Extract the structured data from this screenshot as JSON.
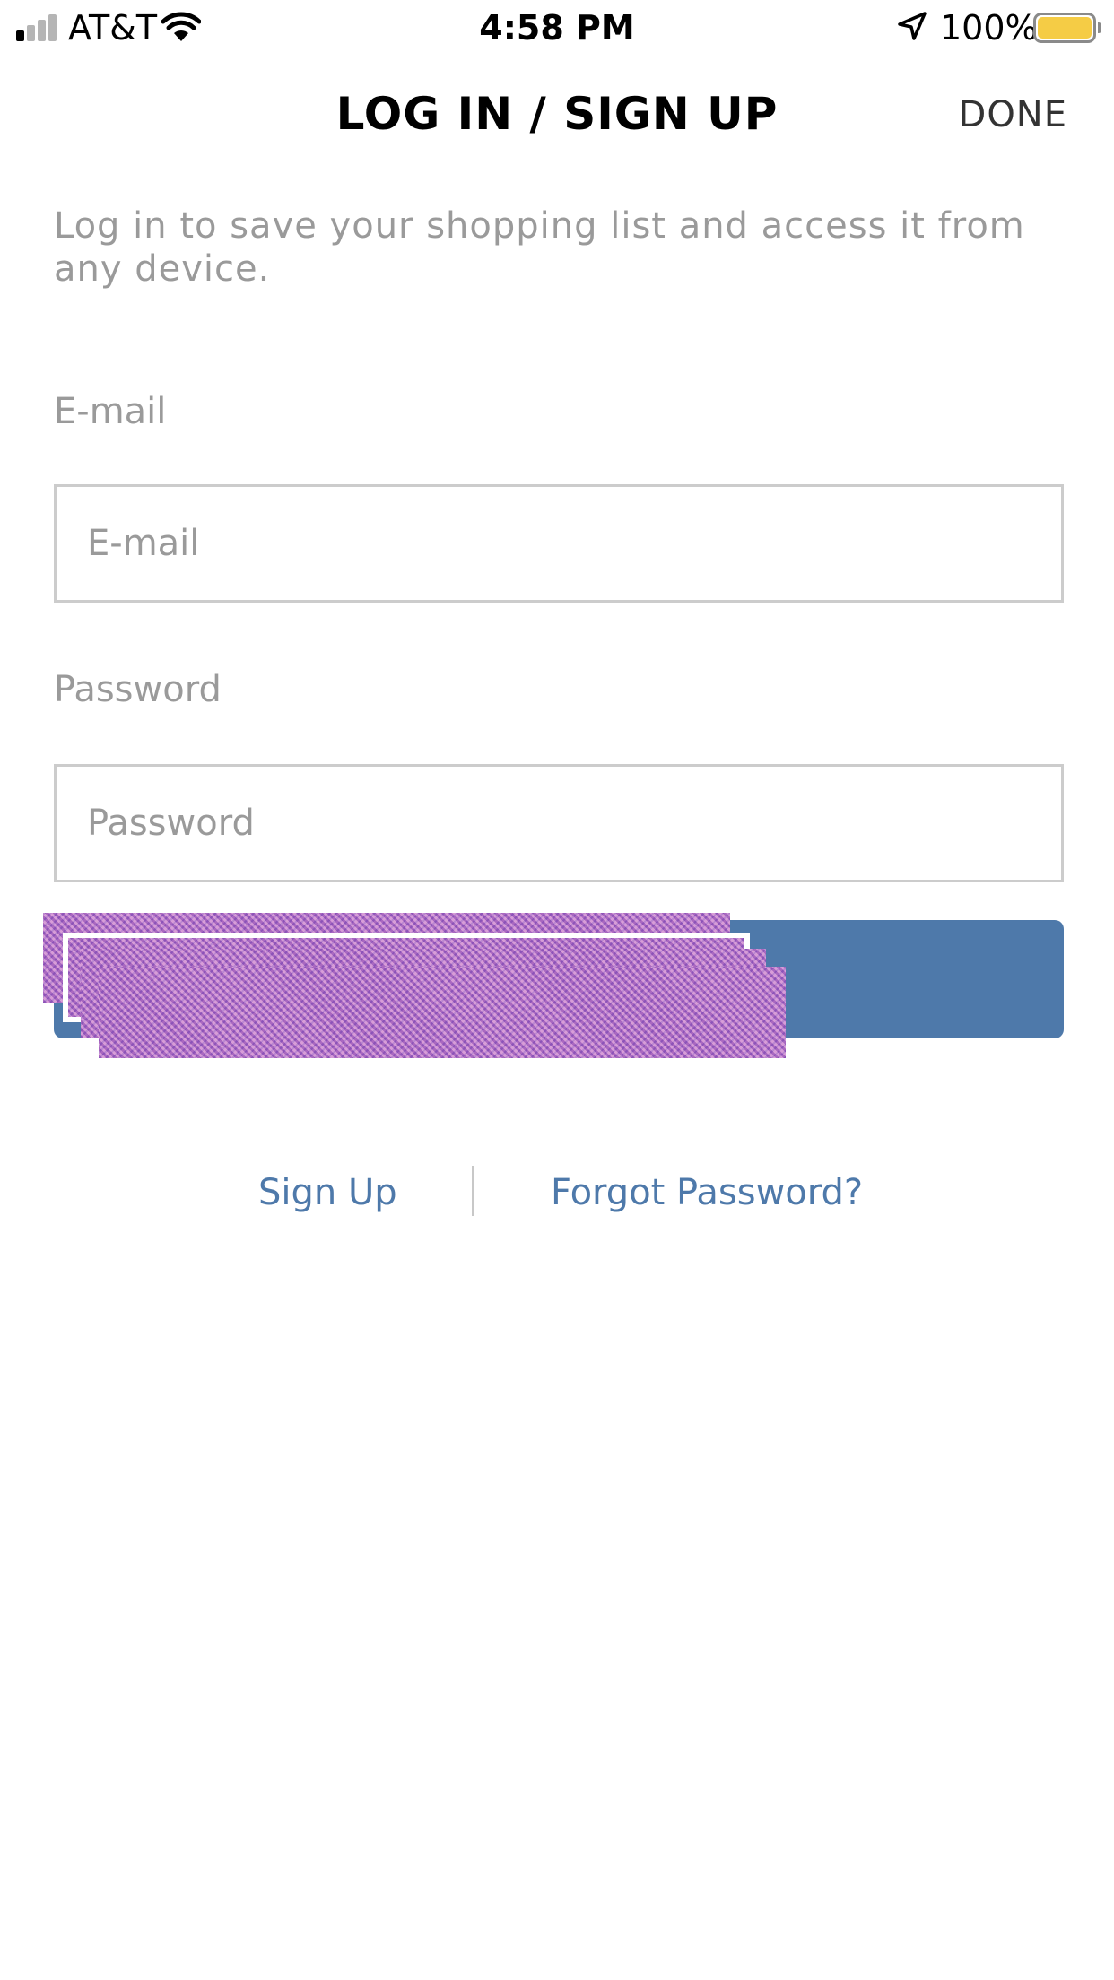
{
  "status_bar": {
    "carrier": "AT&T",
    "time": "4:58 PM",
    "battery_percent": "100%",
    "battery_level": 1.0,
    "battery_color": "#f5cc45",
    "signal_bars_filled": 1,
    "signal_bars_total": 4,
    "icons": [
      "signal-icon",
      "wifi-icon",
      "location-arrow-icon",
      "battery-icon"
    ]
  },
  "header": {
    "title": "LOG IN / SIGN UP",
    "done_label": "DONE"
  },
  "intro_text": "Log in to save your shopping list and access it from any device.",
  "form": {
    "email": {
      "label": "E-mail",
      "placeholder": "E-mail",
      "value": ""
    },
    "password": {
      "label": "Password",
      "placeholder": "Password",
      "value": ""
    },
    "login_button_label": ""
  },
  "links": {
    "sign_up": "Sign Up",
    "forgot_password": "Forgot Password?"
  },
  "colors": {
    "accent": "#4e79aa",
    "link": "#4e79aa",
    "muted_text": "#9a9a9a",
    "input_border": "#cccccc"
  }
}
